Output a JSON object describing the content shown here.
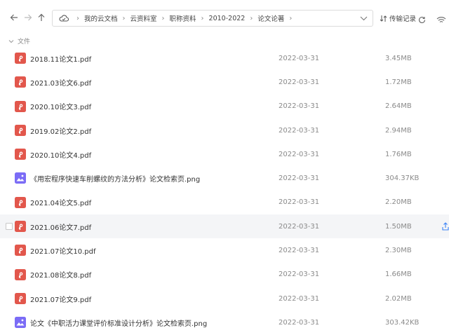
{
  "breadcrumb": [
    "我的云文档",
    "云资料室",
    "职称资料",
    "2010-2022",
    "论文论著"
  ],
  "toolbar": {
    "transfer_label": "传输记录"
  },
  "section": {
    "label": "文件"
  },
  "colors": {
    "pdf": "#e2574c",
    "image": "#7b6cf6",
    "accent": "#3b82f6"
  },
  "files": [
    {
      "name": "2018.11论文1.pdf",
      "date": "2022-03-31",
      "size": "3.45MB",
      "type": "pdf"
    },
    {
      "name": "2021.03论文6.pdf",
      "date": "2022-03-31",
      "size": "1.72MB",
      "type": "pdf"
    },
    {
      "name": "2020.10论文3.pdf",
      "date": "2022-03-31",
      "size": "2.64MB",
      "type": "pdf"
    },
    {
      "name": "2019.02论文2.pdf",
      "date": "2022-03-31",
      "size": "2.94MB",
      "type": "pdf"
    },
    {
      "name": "2020.10论文4.pdf",
      "date": "2022-03-31",
      "size": "1.76MB",
      "type": "pdf"
    },
    {
      "name": "《用宏程序快速车削螺纹的方法分析》论文检索页.png",
      "date": "2022-03-31",
      "size": "304.37KB",
      "type": "image"
    },
    {
      "name": "2021.04论文5.pdf",
      "date": "2022-03-31",
      "size": "2.20MB",
      "type": "pdf"
    },
    {
      "name": "2021.06论文7.pdf",
      "date": "2022-03-31",
      "size": "1.50MB",
      "type": "pdf"
    },
    {
      "name": "2021.07论文10.pdf",
      "date": "2022-03-31",
      "size": "2.30MB",
      "type": "pdf"
    },
    {
      "name": "2021.08论文8.pdf",
      "date": "2022-03-31",
      "size": "1.66MB",
      "type": "pdf"
    },
    {
      "name": "2021.07论文9.pdf",
      "date": "2022-03-31",
      "size": "2.02MB",
      "type": "pdf"
    },
    {
      "name": "论文《中职活力课堂评价标准设计分析》论文检索页.png",
      "date": "2022-03-31",
      "size": "303.42KB",
      "type": "image"
    }
  ]
}
